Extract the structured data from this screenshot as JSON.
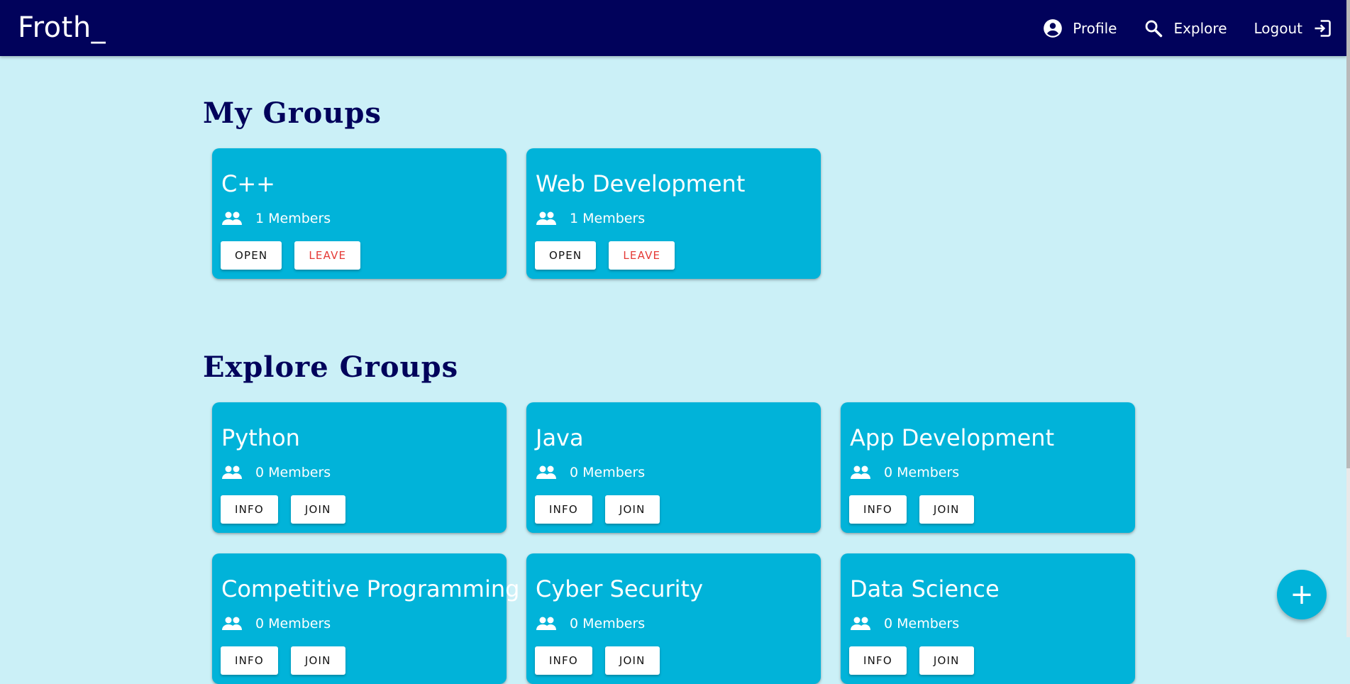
{
  "app": {
    "brand": "Froth_"
  },
  "nav": {
    "profile_label": "Profile",
    "explore_label": "Explore",
    "logout_label": "Logout"
  },
  "sections": {
    "my_groups_title": "My Groups",
    "explore_groups_title": "Explore Groups"
  },
  "my_groups": [
    {
      "name": "C++",
      "members": "1 Members",
      "primary_label": "OPEN",
      "secondary_label": "LEAVE"
    },
    {
      "name": "Web Development",
      "members": "1 Members",
      "primary_label": "OPEN",
      "secondary_label": "LEAVE"
    }
  ],
  "explore_groups": [
    {
      "name": "Python",
      "members": "0 Members",
      "primary_label": "INFO",
      "secondary_label": "JOIN"
    },
    {
      "name": "Java",
      "members": "0 Members",
      "primary_label": "INFO",
      "secondary_label": "JOIN"
    },
    {
      "name": "App Development",
      "members": "0 Members",
      "primary_label": "INFO",
      "secondary_label": "JOIN"
    },
    {
      "name": "Competitive Programming",
      "members": "0 Members",
      "primary_label": "INFO",
      "secondary_label": "JOIN"
    },
    {
      "name": "Cyber Security",
      "members": "0 Members",
      "primary_label": "INFO",
      "secondary_label": "JOIN"
    },
    {
      "name": "Data Science",
      "members": "0 Members",
      "primary_label": "INFO",
      "secondary_label": "JOIN"
    }
  ],
  "fab": {
    "symbol": "+"
  },
  "icons": {
    "profile": "account-circle-icon",
    "explore": "search-icon",
    "logout": "logout-icon",
    "members": "group-icon",
    "fab": "add-icon"
  },
  "colors": {
    "appbar": "#01025b",
    "background": "#cbf0f7",
    "card": "#01b3d9",
    "heading": "#01025b",
    "leave": "#e53935"
  }
}
